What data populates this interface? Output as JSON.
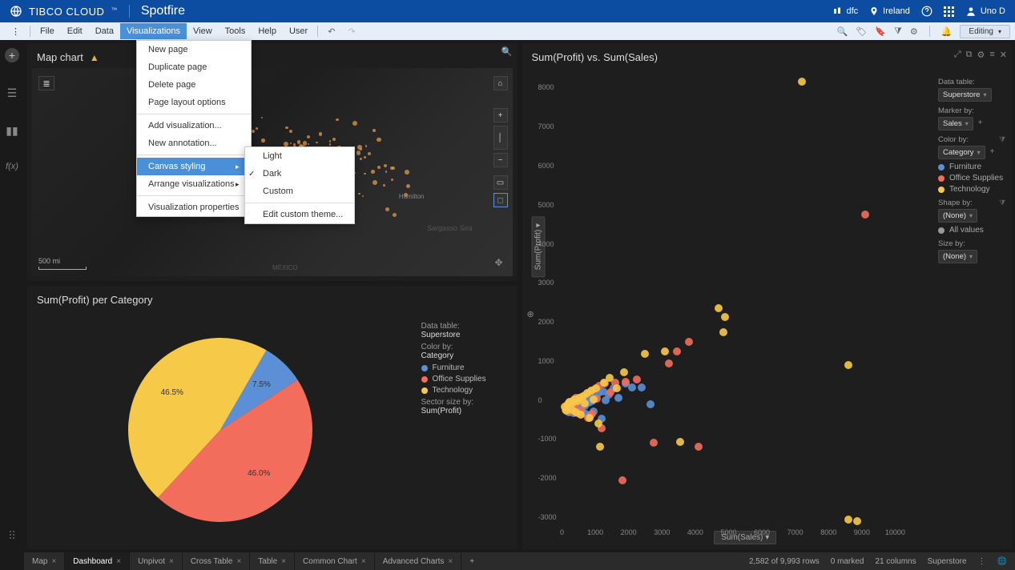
{
  "header": {
    "brand": "TIBCO CLOUD",
    "product": "Spotfire",
    "org": "dfc",
    "location": "Ireland",
    "user": "Uno D"
  },
  "menubar": {
    "items": [
      "File",
      "Edit",
      "Data",
      "Visualizations",
      "View",
      "Tools",
      "Help",
      "User"
    ],
    "active_index": 3,
    "mode_label": "Editing"
  },
  "viz_menu": {
    "items": [
      "New page",
      "Duplicate page",
      "Delete page",
      "Page layout options",
      "Add visualization...",
      "New annotation...",
      "Canvas styling",
      "Arrange visualizations",
      "Visualization properties"
    ],
    "highlighted_index": 6
  },
  "canvas_submenu": {
    "items": [
      "Light",
      "Dark",
      "Custom",
      "Edit custom theme..."
    ],
    "checked_index": 1
  },
  "map": {
    "title": "Map chart",
    "scale": "500 mi",
    "labels": {
      "sargasso": "Sargasso Sea",
      "hamilton": "Hamilton",
      "mexico": "MÉXICO"
    }
  },
  "pie": {
    "title": "Sum(Profit) per Category",
    "legend": {
      "datatable_label": "Data table:",
      "datatable_value": "Superstore",
      "colorby_label": "Color by:",
      "colorby_value": "Category",
      "sector_label": "Sector size by:",
      "sector_value": "Sum(Profit)",
      "items": [
        {
          "label": "Furniture",
          "color": "#5b8fd6"
        },
        {
          "label": "Office Supplies",
          "color": "#f26d5b"
        },
        {
          "label": "Technology",
          "color": "#f7c948"
        }
      ]
    }
  },
  "scatter": {
    "title": "Sum(Profit) vs. Sum(Sales)",
    "xaxis_label": "Sum(Sales) ▾",
    "yaxis_label": "Sum(Profit) ▾",
    "controls": {
      "datatable_label": "Data table:",
      "datatable_value": "Superstore",
      "markerby_label": "Marker by:",
      "markerby_value": "Sales",
      "colorby_label": "Color by:",
      "colorby_value": "Category",
      "shapeby_label": "Shape by:",
      "shapeby_value": "(None)",
      "allvalues_label": "All values",
      "sizeby_label": "Size by:",
      "sizeby_value": "(None)",
      "legend_items": [
        {
          "label": "Furniture",
          "color": "#5b8fd6"
        },
        {
          "label": "Office Supplies",
          "color": "#f26d5b"
        },
        {
          "label": "Technology",
          "color": "#f7c948"
        }
      ]
    }
  },
  "tabs": {
    "items": [
      "Map",
      "Dashboard",
      "Unpivot",
      "Cross Table",
      "Table",
      "Common Chart",
      "Advanced Charts"
    ],
    "active_index": 1
  },
  "status": {
    "rows": "2,582 of 9,993 rows",
    "marked": "0 marked",
    "columns": "21 columns",
    "table": "Superstore"
  },
  "chart_data": [
    {
      "type": "pie",
      "title": "Sum(Profit) per Category",
      "series": [
        {
          "name": "Furniture",
          "value": 7.5,
          "color": "#5b8fd6"
        },
        {
          "name": "Office Supplies",
          "value": 46.0,
          "color": "#f26d5b"
        },
        {
          "name": "Technology",
          "value": 46.5,
          "color": "#f7c948"
        }
      ],
      "value_labels": [
        "7.5%",
        "46.0%",
        "46.5%"
      ]
    },
    {
      "type": "scatter",
      "title": "Sum(Profit) vs. Sum(Sales)",
      "xlabel": "Sum(Sales)",
      "ylabel": "Sum(Profit)",
      "xlim": [
        0,
        11000
      ],
      "ylim": [
        -3000,
        8500
      ],
      "xticks": [
        0,
        1000,
        2000,
        3000,
        4000,
        5000,
        6000,
        7000,
        8000,
        9000,
        10000
      ],
      "yticks": [
        -3000,
        -2000,
        -1000,
        0,
        1000,
        2000,
        3000,
        4000,
        5000,
        6000,
        7000,
        8000
      ],
      "series": [
        {
          "name": "Furniture",
          "color": "#5b8fd6",
          "points": [
            [
              100,
              0
            ],
            [
              200,
              -100
            ],
            [
              250,
              50
            ],
            [
              300,
              80
            ],
            [
              350,
              -120
            ],
            [
              380,
              100
            ],
            [
              420,
              60
            ],
            [
              450,
              150
            ],
            [
              480,
              -80
            ],
            [
              500,
              200
            ],
            [
              520,
              40
            ],
            [
              550,
              120
            ],
            [
              580,
              -50
            ],
            [
              620,
              90
            ],
            [
              650,
              180
            ],
            [
              680,
              60
            ],
            [
              720,
              -150
            ],
            [
              750,
              230
            ],
            [
              800,
              140
            ],
            [
              830,
              -200
            ],
            [
              870,
              300
            ],
            [
              900,
              170
            ],
            [
              950,
              -90
            ],
            [
              1000,
              260
            ],
            [
              1100,
              380
            ],
            [
              1200,
              -280
            ],
            [
              1250,
              420
            ],
            [
              1300,
              200
            ],
            [
              1400,
              350
            ],
            [
              1550,
              510
            ],
            [
              1700,
              250
            ],
            [
              1900,
              630
            ],
            [
              2100,
              520
            ],
            [
              2400,
              520
            ],
            [
              2650,
              100
            ]
          ]
        },
        {
          "name": "Office Supplies",
          "color": "#f26d5b",
          "points": [
            [
              120,
              -40
            ],
            [
              160,
              70
            ],
            [
              210,
              140
            ],
            [
              260,
              -90
            ],
            [
              310,
              50
            ],
            [
              340,
              190
            ],
            [
              370,
              -30
            ],
            [
              400,
              110
            ],
            [
              430,
              250
            ],
            [
              470,
              -120
            ],
            [
              510,
              180
            ],
            [
              560,
              -60
            ],
            [
              590,
              290
            ],
            [
              640,
              130
            ],
            [
              700,
              340
            ],
            [
              770,
              -250
            ],
            [
              830,
              410
            ],
            [
              900,
              -150
            ],
            [
              950,
              470
            ],
            [
              1050,
              230
            ],
            [
              1120,
              560
            ],
            [
              1200,
              -520
            ],
            [
              1280,
              620
            ],
            [
              1450,
              410
            ],
            [
              1600,
              650
            ],
            [
              1820,
              -1850
            ],
            [
              1920,
              670
            ],
            [
              2250,
              730
            ],
            [
              2750,
              -880
            ],
            [
              3200,
              1150
            ],
            [
              3450,
              1440
            ],
            [
              3800,
              1700
            ],
            [
              4100,
              -1000
            ],
            [
              9100,
              4950
            ]
          ]
        },
        {
          "name": "Technology",
          "color": "#f7c948",
          "points": [
            [
              90,
              30
            ],
            [
              140,
              -60
            ],
            [
              190,
              90
            ],
            [
              240,
              160
            ],
            [
              290,
              -40
            ],
            [
              330,
              130
            ],
            [
              380,
              210
            ],
            [
              420,
              -100
            ],
            [
              460,
              170
            ],
            [
              520,
              250
            ],
            [
              570,
              -180
            ],
            [
              630,
              310
            ],
            [
              690,
              120
            ],
            [
              750,
              380
            ],
            [
              820,
              -260
            ],
            [
              880,
              440
            ],
            [
              940,
              210
            ],
            [
              1010,
              510
            ],
            [
              1090,
              -390
            ],
            [
              1150,
              -1000
            ],
            [
              1260,
              640
            ],
            [
              1430,
              770
            ],
            [
              1650,
              510
            ],
            [
              1860,
              920
            ],
            [
              2500,
              1380
            ],
            [
              3100,
              1440
            ],
            [
              3550,
              -870
            ],
            [
              4700,
              2550
            ],
            [
              4900,
              2320
            ],
            [
              4850,
              1950
            ],
            [
              7200,
              8350
            ],
            [
              8600,
              1100
            ],
            [
              8600,
              -2850
            ],
            [
              8850,
              -2900
            ]
          ]
        }
      ]
    }
  ]
}
